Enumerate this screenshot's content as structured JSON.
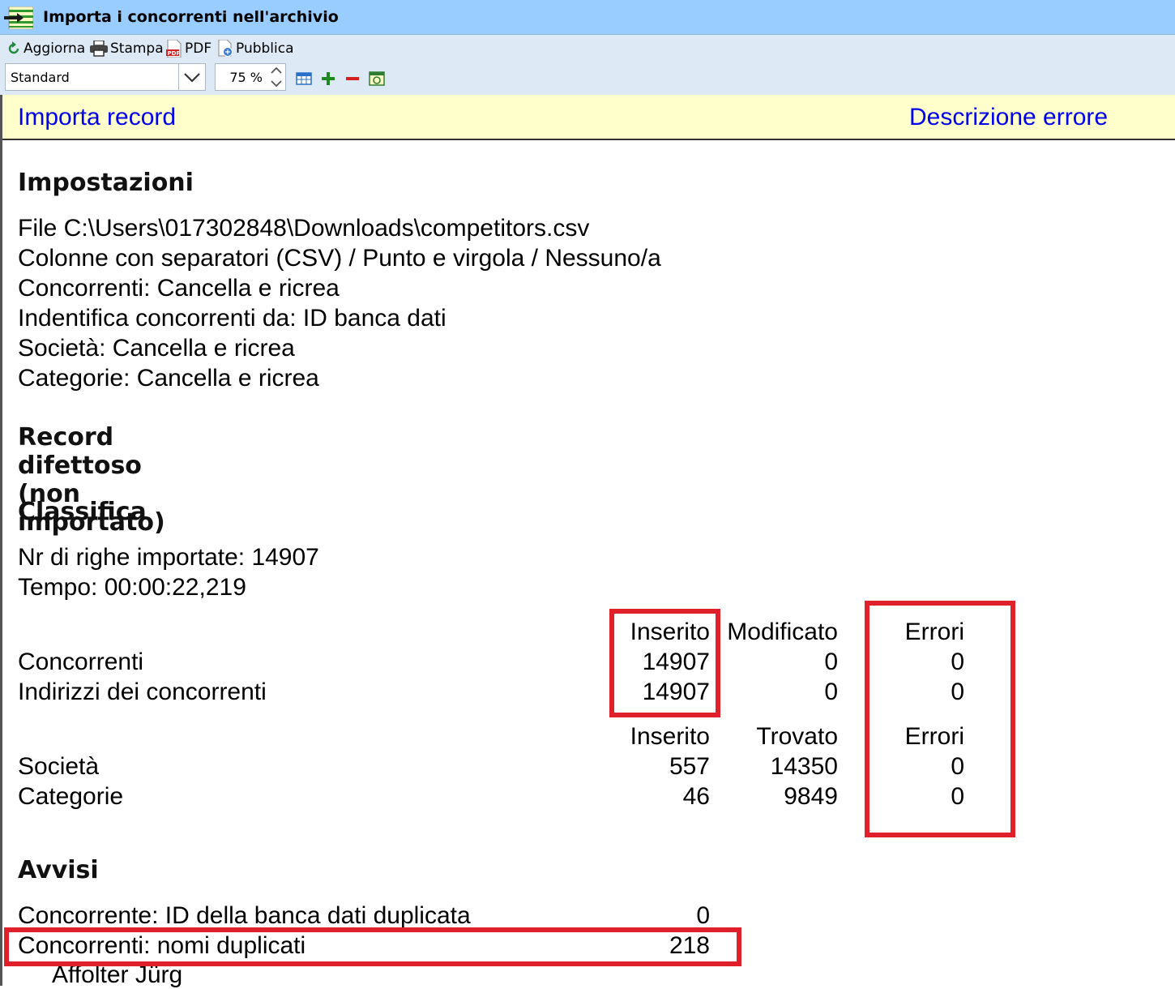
{
  "window": {
    "title": "Importa i concorrenti nell'archivio"
  },
  "toolbar": {
    "refresh_label": "Aggiorna",
    "print_label": "Stampa",
    "pdf_label": "PDF",
    "publish_label": "Pubblica",
    "layout_value": "Standard",
    "zoom_value": "75 %"
  },
  "links": {
    "import_record": "Importa record",
    "error_description": "Descrizione errore"
  },
  "settings": {
    "heading": "Impostazioni",
    "lines": [
      "File C:\\Users\\017302848\\Downloads\\competitors.csv",
      "Colonne con separatori (CSV) / Punto e virgola / Nessuno/a",
      "Concorrenti: Cancella e ricrea",
      "Indentifica concorrenti da: ID banca dati",
      "Società: Cancella e ricrea",
      "Categorie: Cancella e ricrea"
    ]
  },
  "faulty": {
    "heading": "Record difettoso (non importato)"
  },
  "ranking": {
    "heading": "Classifica",
    "rows_imported": "Nr di righe importate: 14907",
    "time": "Tempo: 00:00:22,219",
    "table1": {
      "headers": [
        "Inserito",
        "Modificato",
        "Errori"
      ],
      "rows": [
        {
          "label": "Concorrenti",
          "values": [
            "14907",
            "0",
            "0"
          ]
        },
        {
          "label": "Indirizzi dei concorrenti",
          "values": [
            "14907",
            "0",
            "0"
          ]
        }
      ]
    },
    "table2": {
      "headers": [
        "Inserito",
        "Trovato",
        "Errori"
      ],
      "rows": [
        {
          "label": "Società",
          "values": [
            "557",
            "14350",
            "0"
          ]
        },
        {
          "label": "Categorie",
          "values": [
            "46",
            "9849",
            "0"
          ]
        }
      ]
    }
  },
  "warnings": {
    "heading": "Avvisi",
    "rows": [
      {
        "label": "Concorrente: ID della banca dati duplicata",
        "value": "0"
      },
      {
        "label": "Concorrenti: nomi duplicati",
        "value": "218"
      }
    ],
    "sub_item": "Affolter Jürg"
  },
  "colors": {
    "highlight": "#e0202a",
    "link": "#0000ee",
    "linkbar_bg": "#ffffcc",
    "titlebar_bg": "#99ccff"
  }
}
